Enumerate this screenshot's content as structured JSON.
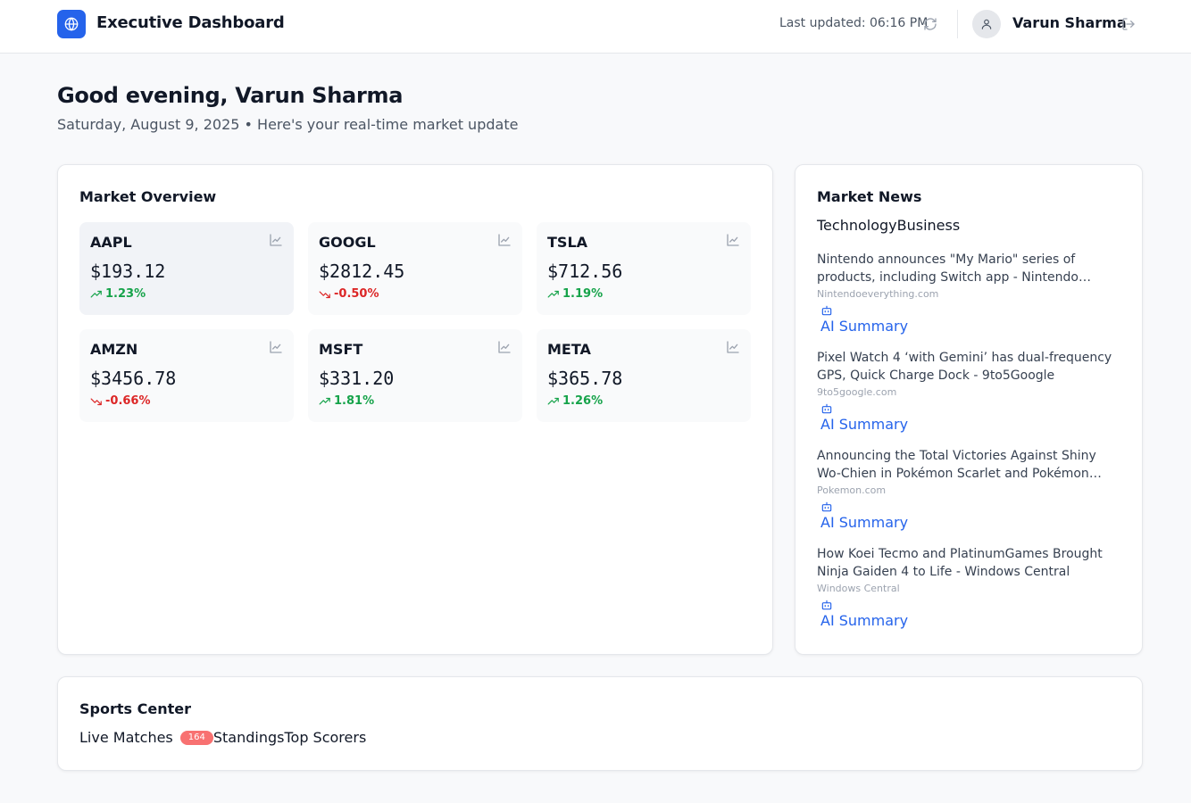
{
  "header": {
    "app_title": "Executive Dashboard",
    "last_updated": "Last updated: 06:16 PM",
    "user_name": "Varun Sharma",
    "brand_color": "#2563eb"
  },
  "greeting": {
    "title": "Good evening, Varun Sharma",
    "subtitle": "Saturday, August 9, 2025 • Here's your real-time market update"
  },
  "market": {
    "title": "Market Overview",
    "stocks": [
      {
        "symbol": "AAPL",
        "price": "$193.12",
        "change": "1.23%",
        "direction": "up"
      },
      {
        "symbol": "GOOGL",
        "price": "$2812.45",
        "change": "-0.50%",
        "direction": "down"
      },
      {
        "symbol": "TSLA",
        "price": "$712.56",
        "change": "1.19%",
        "direction": "up"
      },
      {
        "symbol": "AMZN",
        "price": "$3456.78",
        "change": "-0.66%",
        "direction": "down"
      },
      {
        "symbol": "MSFT",
        "price": "$331.20",
        "change": "1.81%",
        "direction": "up"
      },
      {
        "symbol": "META",
        "price": "$365.78",
        "change": "1.26%",
        "direction": "up"
      }
    ]
  },
  "news": {
    "title": "Market News",
    "tabs": [
      "Technology",
      "Business"
    ],
    "ai_label": "AI Summary",
    "items": [
      {
        "title": "Nintendo announces \"My Mario\" series of products, including Switch app - Nintendo Everything",
        "source": "Nintendoeverything.com"
      },
      {
        "title": "Pixel Watch 4 ‘with Gemini’ has dual-frequency GPS, Quick Charge Dock - 9to5Google",
        "source": "9to5google.com"
      },
      {
        "title": "Announcing the Total Victories Against Shiny Wo-Chien in Pokémon Scarlet and Pokémon Violet - Pokemon.com",
        "source": "Pokemon.com"
      },
      {
        "title": "How Koei Tecmo and PlatinumGames Brought Ninja Gaiden 4 to Life - Windows Central",
        "source": "Windows Central"
      }
    ]
  },
  "sports": {
    "title": "Sports Center",
    "tabs": [
      "Live Matches",
      "Standings",
      "Top Scorers"
    ],
    "live_count": "164"
  }
}
